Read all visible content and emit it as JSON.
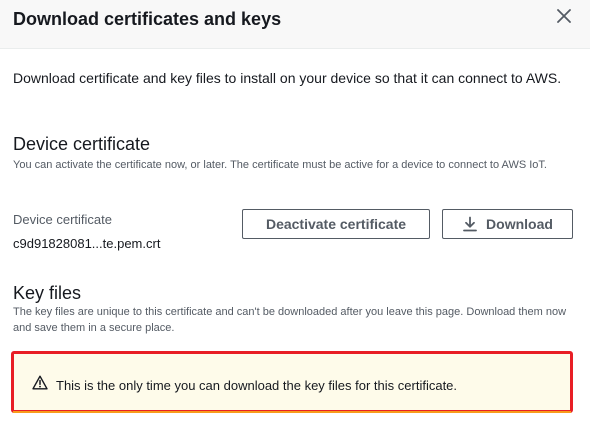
{
  "modal": {
    "title": "Download certificates and keys",
    "close_icon": "close-icon"
  },
  "intro": "Download certificate and key files to install on your device so that it can connect to AWS.",
  "device_certificate": {
    "heading": "Device certificate",
    "description": "You can activate the certificate now, or later. The certificate must be active for a device to connect to AWS IoT.",
    "field_label": "Device certificate",
    "file_name": "c9d91828081...te.pem.crt",
    "deactivate_label": "Deactivate certificate",
    "download_label": "Download",
    "download_icon": "download-icon"
  },
  "key_files": {
    "heading": "Key files",
    "description": "The key files are unique to this certificate and can't be downloaded after you leave this page. Download them now and save them in a secure place."
  },
  "alert": {
    "icon": "warning-icon",
    "text": "This is the only time you can download the key files for this certificate.",
    "highlight_color": "#e81e25",
    "background_color": "#fefbea"
  }
}
